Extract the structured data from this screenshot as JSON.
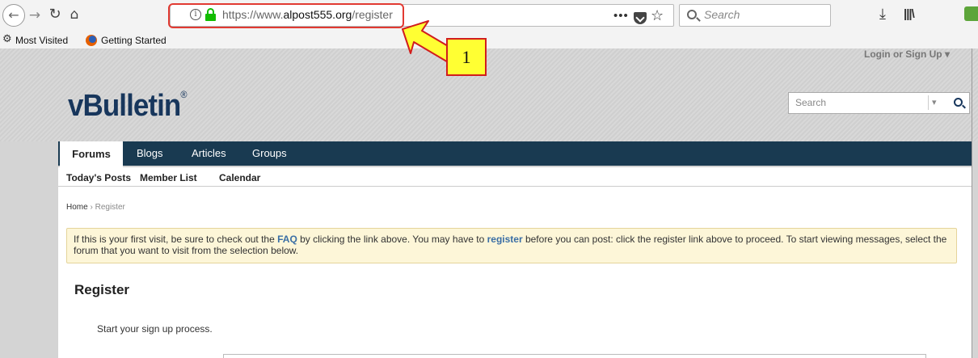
{
  "browser": {
    "url_prefix": "https://www.",
    "url_domain": "alpost555.org",
    "url_path": "/register",
    "more_label": "•••",
    "search_placeholder": "Search",
    "bookmarks": {
      "most_visited": "Most Visited",
      "getting_started": "Getting Started"
    }
  },
  "site": {
    "login_link": "Login or Sign Up ▾",
    "logo_text": "vBulletin",
    "logo_mark": "®",
    "search_placeholder": "Search",
    "tabs": [
      {
        "label": "Forums",
        "active": true
      },
      {
        "label": "Blogs"
      },
      {
        "label": "Articles"
      },
      {
        "label": "Groups"
      }
    ],
    "subnav": [
      "Today's Posts",
      "Member List",
      "Calendar"
    ],
    "breadcrumb": {
      "home": "Home",
      "sep": "›",
      "current": "Register"
    },
    "notice": {
      "part1": "If this is your first visit, be sure to check out the ",
      "faq": "FAQ",
      "part2": " by clicking the link above. You may have to ",
      "register": "register",
      "part3": " before you can post: click the register link above to proceed. To start viewing messages, select the forum that you want to visit from the selection below."
    },
    "register_title": "Register",
    "register_subtitle": "Start your sign up process."
  },
  "annotation": {
    "step": "1",
    "highlight_color": "#e23a32",
    "callout_color": "#ffff33"
  },
  "colors": {
    "nav_bg": "#193a51",
    "logo": "#17365c",
    "link": "#3a6ea5",
    "notice_bg": "#fdf6d8",
    "lock": "#12bc00"
  },
  "icons": [
    "back-arrow-icon",
    "forward-arrow-icon",
    "reload-icon",
    "home-icon",
    "info-icon",
    "lock-icon",
    "more-icon",
    "pocket-icon",
    "star-icon",
    "search-icon",
    "download-icon",
    "library-icon",
    "extension-icon",
    "gear-icon",
    "firefox-icon"
  ]
}
